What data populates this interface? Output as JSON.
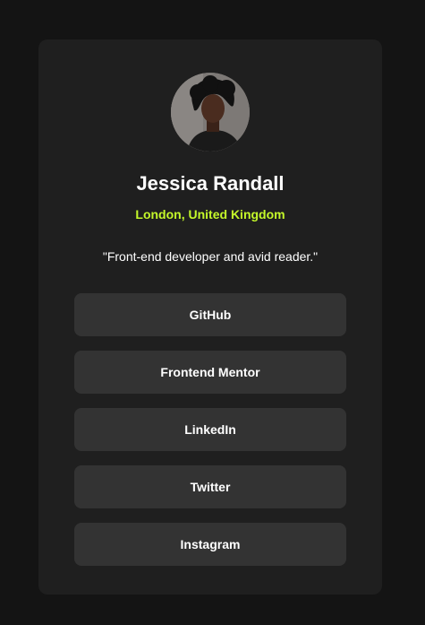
{
  "profile": {
    "avatar_alt": "Jessica Randall",
    "name": "Jessica Randall",
    "location": "London, United Kingdom",
    "bio": "\"Front-end developer and avid reader.\""
  },
  "links": [
    {
      "label": "GitHub"
    },
    {
      "label": "Frontend Mentor"
    },
    {
      "label": "LinkedIn"
    },
    {
      "label": "Twitter"
    },
    {
      "label": "Instagram"
    }
  ],
  "colors": {
    "page_background": "#141414",
    "card_background": "#1f1f1f",
    "button_background": "#333333",
    "accent": "#c4f82a",
    "text": "#ffffff"
  }
}
